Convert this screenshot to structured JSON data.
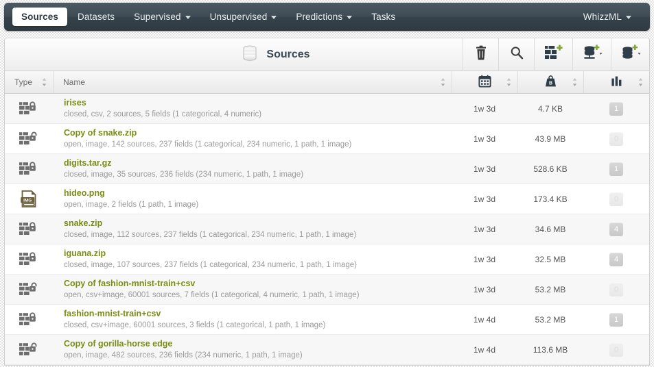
{
  "nav": {
    "items": [
      {
        "label": "Sources",
        "active": true,
        "dropdown": false
      },
      {
        "label": "Datasets",
        "active": false,
        "dropdown": false
      },
      {
        "label": "Supervised",
        "active": false,
        "dropdown": true
      },
      {
        "label": "Unsupervised",
        "active": false,
        "dropdown": true
      },
      {
        "label": "Predictions",
        "active": false,
        "dropdown": true
      },
      {
        "label": "Tasks",
        "active": false,
        "dropdown": false
      }
    ],
    "account": {
      "label": "WhizzML",
      "dropdown": true
    }
  },
  "panel": {
    "title": "Sources",
    "title_icon": "database-icon",
    "tools": [
      {
        "name": "delete-icon",
        "label": "Delete"
      },
      {
        "name": "search-icon",
        "label": "Search"
      },
      {
        "name": "add-composite-source-icon",
        "label": "Create composite source"
      },
      {
        "name": "add-source-stack-icon",
        "label": "Create source"
      },
      {
        "name": "add-database-source-icon",
        "label": "Add source"
      }
    ]
  },
  "columns": {
    "type": "Type",
    "name": "Name",
    "date_icon": "calendar-icon",
    "size_icon": "weight-icon",
    "count_icon": "bar-chart-icon"
  },
  "rows": [
    {
      "icon": "closed-composite-icon",
      "name": "irises",
      "desc": "closed, csv, 2 sources, 5 fields (1 categorical, 4 numeric)",
      "age": "1w 3d",
      "size": "4.7 KB",
      "count": "1"
    },
    {
      "icon": "open-composite-icon",
      "name": "Copy of snake.zip",
      "desc": "open, image, 142 sources, 237 fields (1 categorical, 234 numeric, 1 path, 1 image)",
      "age": "1w 3d",
      "size": "43.9 MB",
      "count": "0"
    },
    {
      "icon": "closed-composite-icon",
      "name": "digits.tar.gz",
      "desc": "closed, image, 35 sources, 236 fields (234 numeric, 1 path, 1 image)",
      "age": "1w 3d",
      "size": "528.6 KB",
      "count": "1"
    },
    {
      "icon": "image-file-icon",
      "name": "hideo.png",
      "desc": "open, image, 2 fields (1 path, 1 image)",
      "age": "1w 3d",
      "size": "173.4 KB",
      "count": "0"
    },
    {
      "icon": "closed-composite-icon",
      "name": "snake.zip",
      "desc": "closed, image, 112 sources, 237 fields (1 categorical, 234 numeric, 1 path, 1 image)",
      "age": "1w 3d",
      "size": "34.6 MB",
      "count": "4"
    },
    {
      "icon": "closed-composite-icon",
      "name": "iguana.zip",
      "desc": "closed, image, 107 sources, 237 fields (1 categorical, 234 numeric, 1 path, 1 image)",
      "age": "1w 3d",
      "size": "32.5 MB",
      "count": "4"
    },
    {
      "icon": "open-composite-icon",
      "name": "Copy of fashion-mnist-train+csv",
      "desc": "open, csv+image, 60001 sources, 7 fields (1 categorical, 4 numeric, 1 path, 1 image)",
      "age": "1w 3d",
      "size": "53.2 MB",
      "count": "0"
    },
    {
      "icon": "closed-composite-icon",
      "name": "fashion-mnist-train+csv",
      "desc": "closed, csv+image, 60001 sources, 3 fields (1 categorical, 1 path, 1 image)",
      "age": "1w 4d",
      "size": "53.2 MB",
      "count": "1"
    },
    {
      "icon": "open-composite-icon",
      "name": "Copy of gorilla-horse edge",
      "desc": "open, image, 482 sources, 236 fields (234 numeric, 1 path, 1 image)",
      "age": "1w 4d",
      "size": "113.6 MB",
      "count": "0"
    }
  ],
  "colors": {
    "nav_dark": "#3a4750",
    "source_link": "#7a8c12",
    "accent_green": "#7fa52b",
    "icon_dark": "#2f3e49",
    "muted_text": "#9b9b9b"
  }
}
